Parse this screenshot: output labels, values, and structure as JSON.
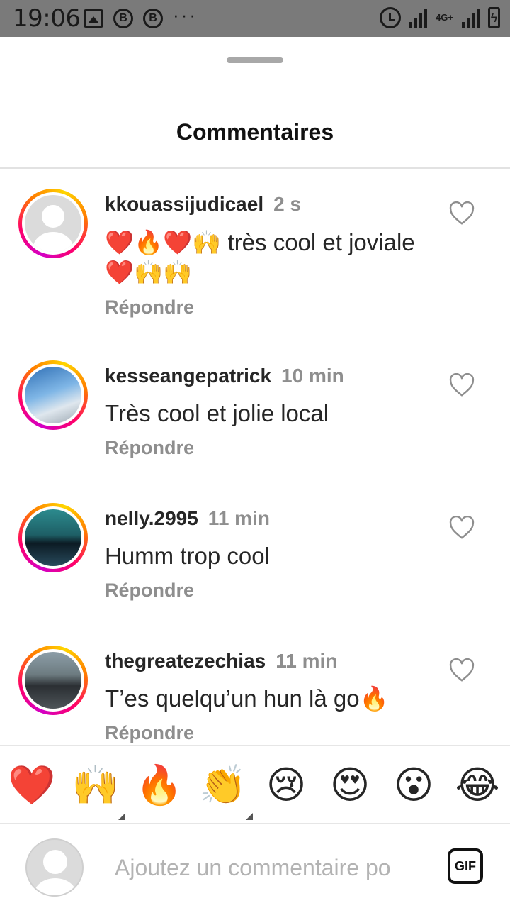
{
  "status_bar": {
    "time": "19:06",
    "b1": "B",
    "b2": "B",
    "dots": "···",
    "network": "4G+"
  },
  "sheet": {
    "title": "Commentaires"
  },
  "comments": [
    {
      "username": "kkouassijudicael",
      "time": "2 s",
      "text": "❤️🔥❤️🙌 très cool et joviale ❤️🙌🙌",
      "reply": "Répondre",
      "avatar": "default"
    },
    {
      "username": "kesseangepatrick",
      "time": "10 min",
      "text": "Très cool et jolie local",
      "reply": "Répondre",
      "avatar": "photo"
    },
    {
      "username": "nelly.2995",
      "time": "11 min",
      "text": "Humm trop cool",
      "reply": "Répondre",
      "avatar": "photo"
    },
    {
      "username": "thegreatezechias",
      "time": "11 min",
      "text": "T’es quelqu’un hun là go🔥",
      "reply": "Répondre",
      "avatar": "photo"
    }
  ],
  "emoji_bar": [
    "❤️",
    "🙌",
    "🔥",
    "👏",
    "😢",
    "😍",
    "😮",
    "😂"
  ],
  "input": {
    "placeholder": "Ajoutez un commentaire po",
    "gif_label": "GIF"
  },
  "colors": {
    "story_ring_start": "#d300c5",
    "story_ring_end": "#ffd600",
    "secondary_text": "#8e8e8e"
  }
}
